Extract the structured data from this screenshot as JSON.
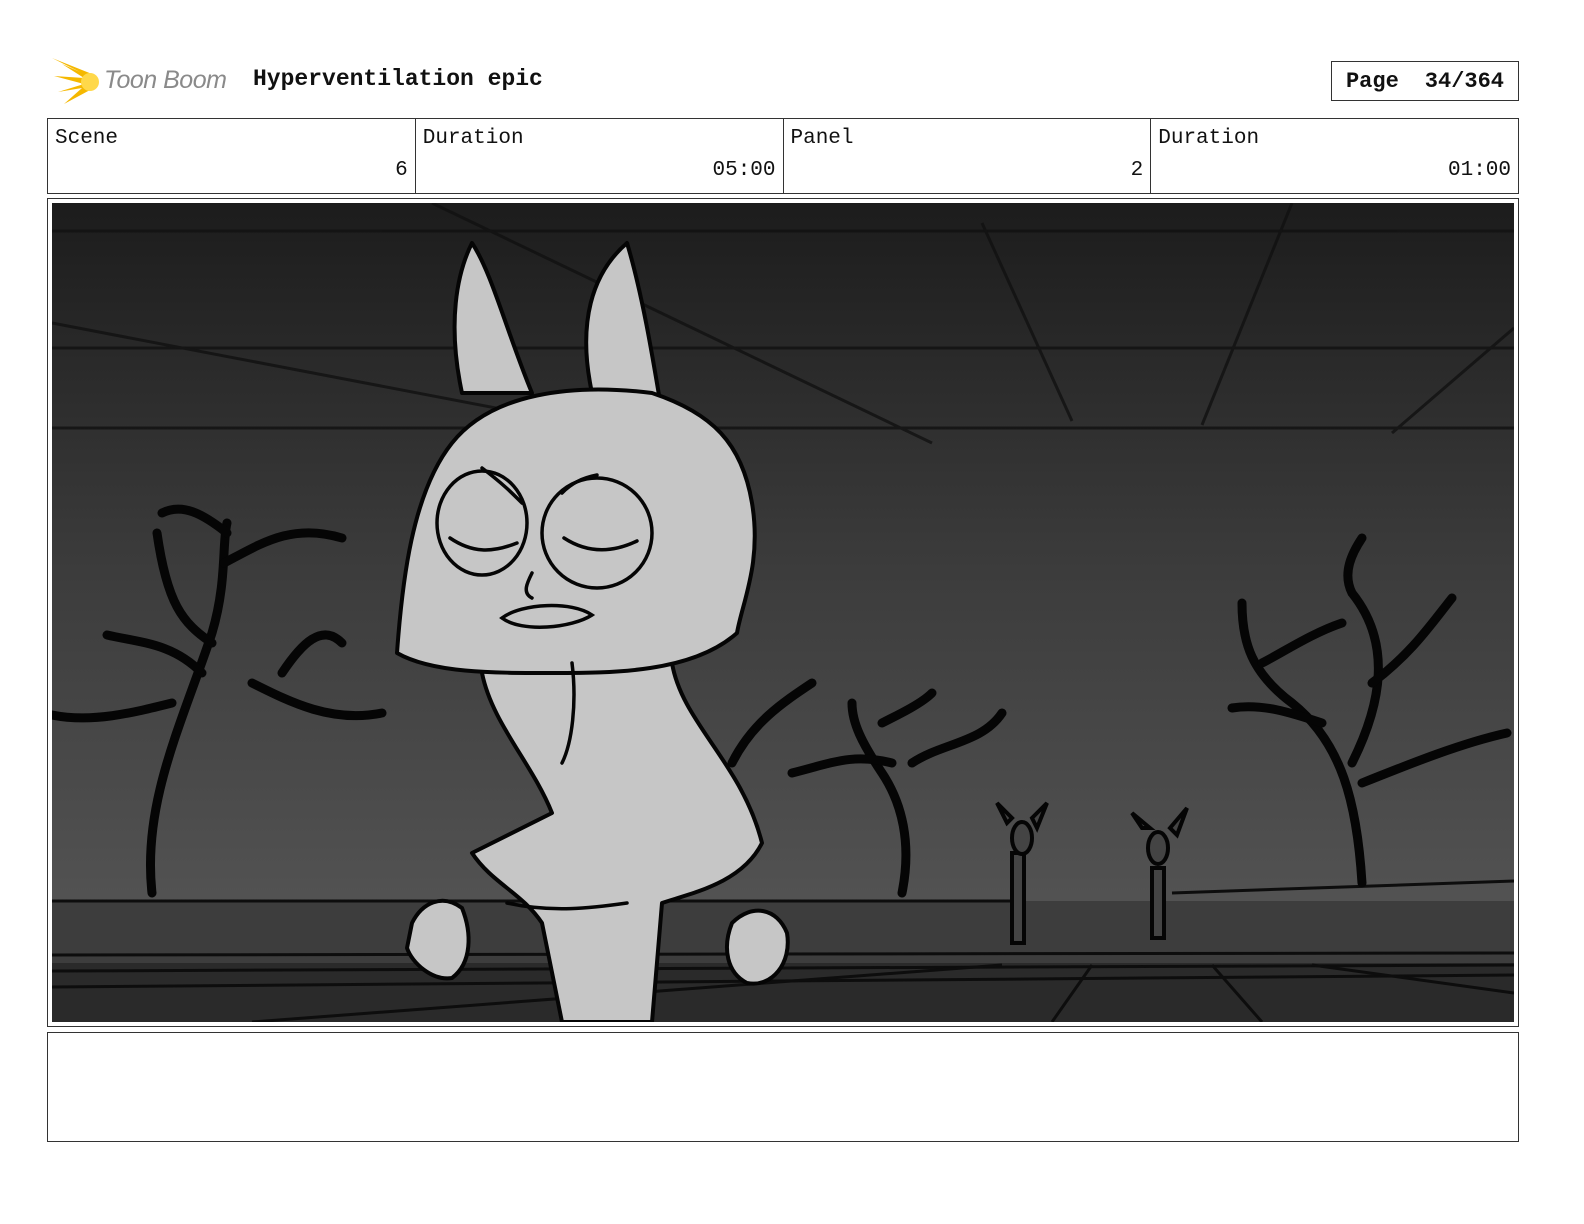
{
  "header": {
    "logo_text": "Toon Boom",
    "title": "Hyperventilation epic",
    "page_label": "Page",
    "page_number": "34/364"
  },
  "info": {
    "scene_label": "Scene",
    "scene_value": "6",
    "scene_duration_label": "Duration",
    "scene_duration_value": "05:00",
    "panel_label": "Panel",
    "panel_value": "2",
    "panel_duration_label": "Duration",
    "panel_duration_value": "01:00"
  },
  "colors": {
    "logo_flame": "#f5b800",
    "logo_text": "#8a8a8a",
    "border": "#333333"
  }
}
